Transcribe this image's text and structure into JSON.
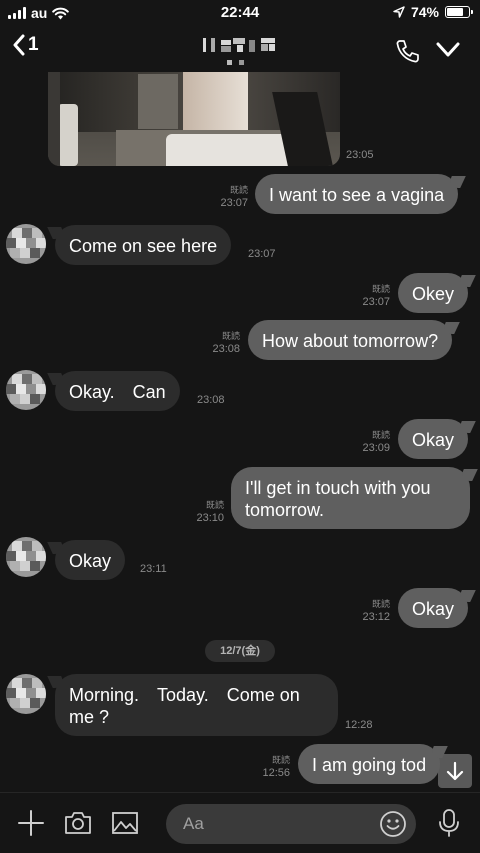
{
  "status_bar": {
    "carrier": "au",
    "time": "22:44",
    "battery_percent": "74%",
    "battery_level": 0.74,
    "icons": [
      "signal-icon",
      "wifi-icon",
      "location-arrow-icon",
      "battery-icon"
    ]
  },
  "header": {
    "back_count": "1",
    "back_icon": "chevron-left-icon",
    "call_icon": "phone-icon",
    "menu_icon": "chevron-down-icon"
  },
  "messages": [
    {
      "side": "out",
      "text": "",
      "kind": "photo",
      "time": "23:05"
    },
    {
      "side": "out",
      "text": "I want to see a vagina",
      "read": "既読",
      "time": "23:07"
    },
    {
      "side": "in",
      "text": "Come on see here",
      "time": "23:07"
    },
    {
      "side": "out",
      "text": "Okey",
      "read": "既読",
      "time": "23:07"
    },
    {
      "side": "out",
      "text": "How about tomorrow?",
      "read": "既読",
      "time": "23:08"
    },
    {
      "side": "in",
      "text": "Okay.　Can",
      "time": "23:08"
    },
    {
      "side": "out",
      "text": "Okay",
      "read": "既読",
      "time": "23:09"
    },
    {
      "side": "out",
      "text": "I'll get in touch with you tomorrow.",
      "read": "既読",
      "time": "23:10"
    },
    {
      "side": "in",
      "text": "Okay",
      "time": "23:11"
    },
    {
      "side": "out",
      "text": "Okay",
      "read": "既読",
      "time": "23:12"
    },
    {
      "side": "in",
      "text": "Morning.　Today.　Come on me ?",
      "time": "12:28"
    },
    {
      "side": "out",
      "text": "I am going tod",
      "read": "既読",
      "time": "12:56"
    }
  ],
  "date_separator": "12/7(金)",
  "input_bar": {
    "placeholder": "Aa",
    "icons": [
      "plus-icon",
      "camera-icon",
      "image-icon",
      "emoji-icon",
      "microphone-icon"
    ]
  },
  "colors": {
    "background": "#151515",
    "bubble_out": "#5f5f5f",
    "bubble_in": "#2c2c2c",
    "meta_text": "#8a8a8a"
  }
}
